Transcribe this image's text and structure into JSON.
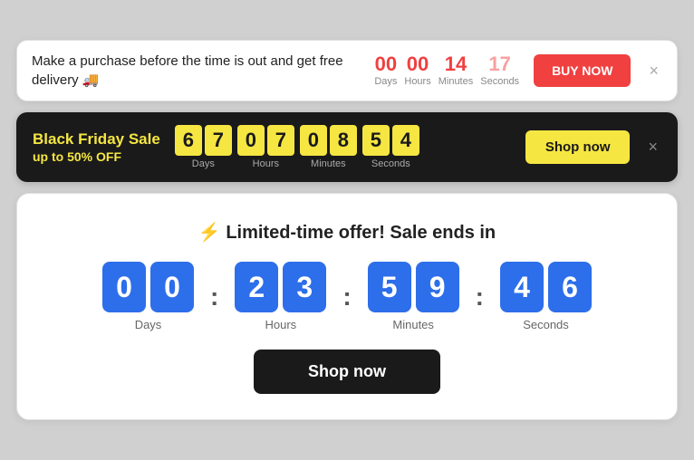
{
  "banner1": {
    "text": "Make a purchase before the time is out and get free delivery 🚚",
    "countdown": {
      "days": {
        "value": "00",
        "label": "Days"
      },
      "hours": {
        "value": "00",
        "label": "Hours"
      },
      "minutes": {
        "value": "14",
        "label": "Minutes"
      },
      "seconds": {
        "value": "17",
        "label": "Seconds"
      }
    },
    "buy_button": "BUY NOW",
    "close": "×"
  },
  "banner2": {
    "title": "Black Friday Sale",
    "subtitle": "up to 50% OFF",
    "countdown": {
      "days": {
        "digits": [
          "6",
          "7"
        ],
        "label": "Days"
      },
      "hours": {
        "digits": [
          "0",
          "7"
        ],
        "label": "Hours"
      },
      "minutes": {
        "digits": [
          "0",
          "8"
        ],
        "label": "Minutes"
      },
      "seconds": {
        "digits": [
          "5",
          "4"
        ],
        "label": "Seconds"
      }
    },
    "shop_button": "Shop now",
    "close": "×"
  },
  "banner3": {
    "title": "⚡ Limited-time offer! Sale ends in",
    "countdown": {
      "days": {
        "digits": [
          "0",
          "0"
        ],
        "label": "Days"
      },
      "hours": {
        "digits": [
          "2",
          "3"
        ],
        "label": "Hours"
      },
      "minutes": {
        "digits": [
          "5",
          "9"
        ],
        "label": "Minutes"
      },
      "seconds": {
        "digits": [
          "4",
          "6"
        ],
        "label": "Seconds"
      }
    },
    "shop_button": "Shop now"
  }
}
